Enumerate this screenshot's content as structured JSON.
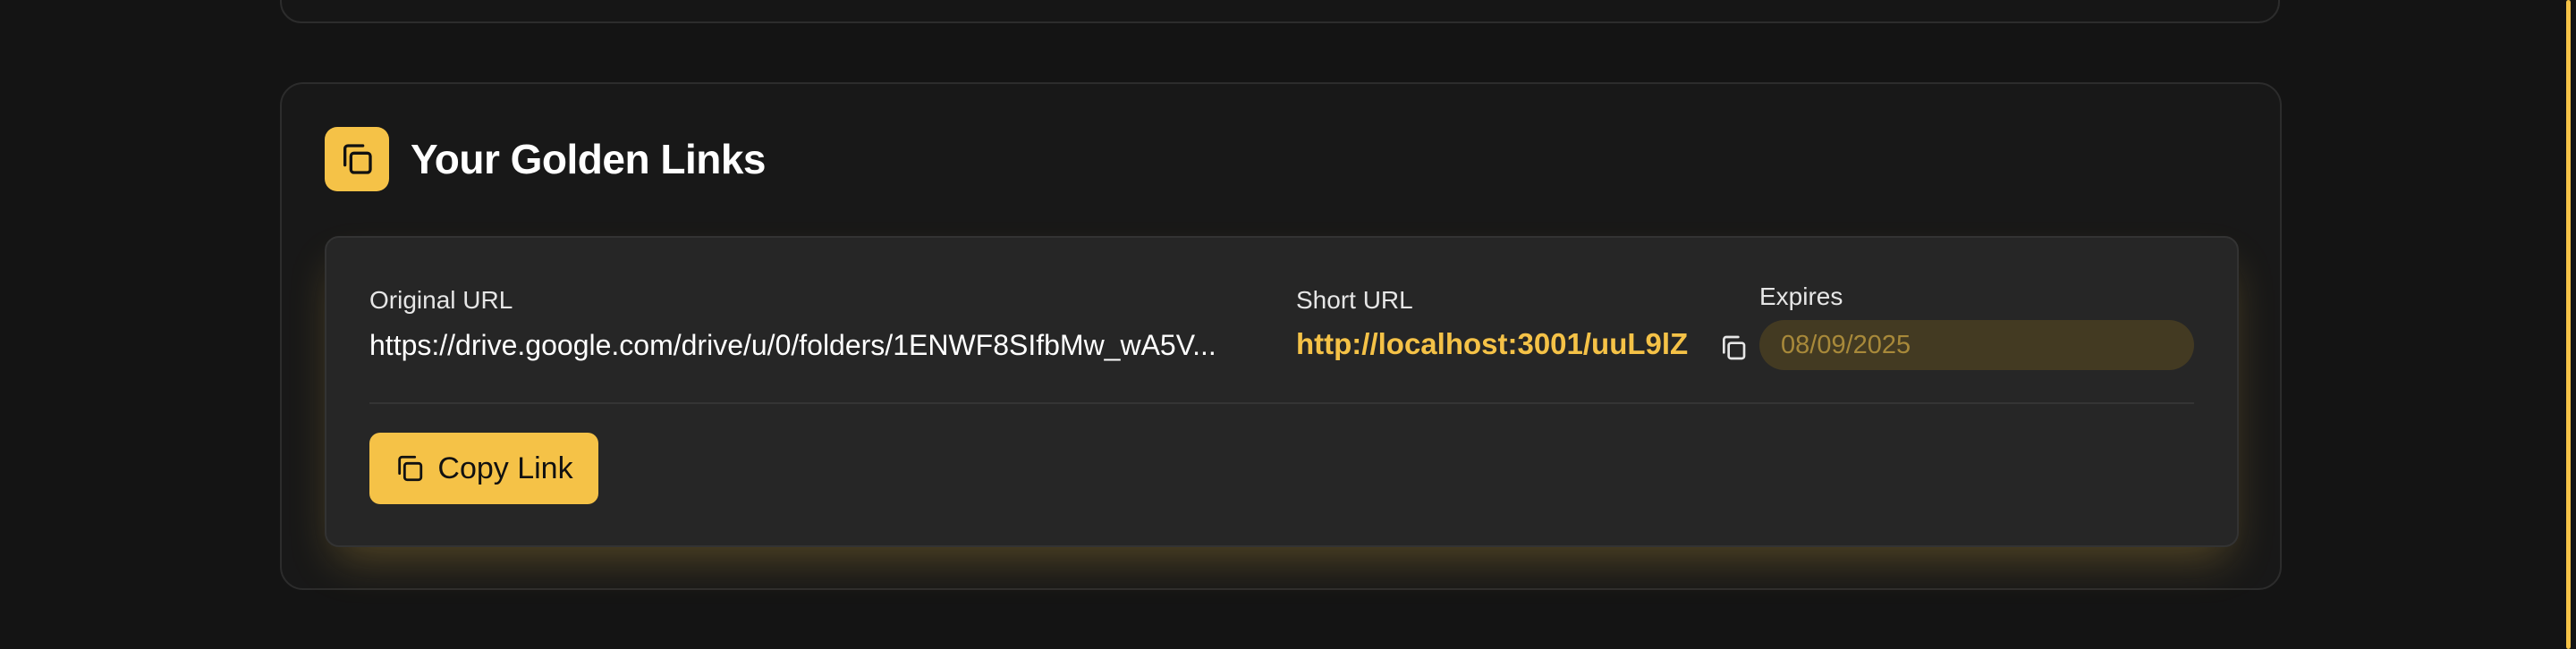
{
  "section": {
    "title": "Your Golden Links",
    "header_icon": "copy-icon"
  },
  "link": {
    "original_label": "Original URL",
    "original_url": "https://drive.google.com/drive/u/0/folders/1ENWF8SIfbMw_wA5V...",
    "short_label": "Short URL",
    "short_url": "http://localhost:3001/uuL9lZ",
    "copy_icon": "copy-icon",
    "expires_label": "Expires",
    "expires_value": "08/09/2025",
    "copy_button_label": "Copy Link",
    "copy_button_icon": "copy-icon"
  },
  "colors": {
    "accent": "#f5c247",
    "background": "#141414",
    "card": "#181818",
    "panel": "#262626",
    "expires_bg": "#433a22"
  }
}
